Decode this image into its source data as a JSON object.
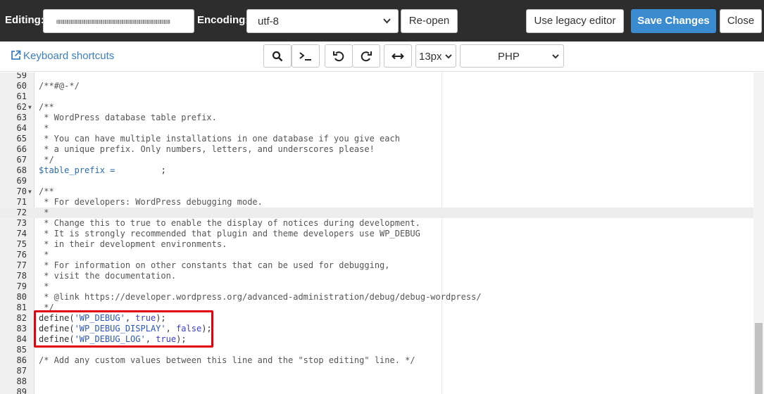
{
  "header": {
    "editing_label": "Editing:",
    "encoding_label": "Encoding:",
    "encoding_value": "utf-8",
    "reopen_label": "Re-open",
    "legacy_label": "Use legacy editor",
    "save_label": "Save Changes",
    "close_label": "Close"
  },
  "toolbar": {
    "shortcuts_label": "Keyboard shortcuts",
    "font_size": "13px",
    "mode": "PHP",
    "icons": [
      "search-icon",
      "terminal-icon",
      "undo-icon",
      "redo-icon",
      "wrap-icon"
    ]
  },
  "editor": {
    "line_numbers": [
      "59",
      "60",
      "61",
      "62",
      "63",
      "64",
      "65",
      "66",
      "67",
      "68",
      "69",
      "70",
      "71",
      "72",
      "73",
      "74",
      "75",
      "76",
      "77",
      "78",
      "79",
      "80",
      "81",
      "82",
      "83",
      "84",
      "85",
      "86",
      "87",
      "88",
      "89"
    ],
    "fold_markers": [
      "",
      "",
      "",
      "▼",
      "",
      "",
      "",
      "",
      "",
      "",
      "",
      "▼",
      "",
      "",
      "",
      "",
      "",
      "",
      "",
      "",
      "",
      "",
      "",
      "",
      "",
      "",
      "",
      "",
      "",
      "",
      ""
    ],
    "lines": [
      "",
      "/**#@-*/",
      "",
      "/**",
      " * WordPress database table prefix.",
      " *",
      " * You can have multiple installations in one database if you give each",
      " * a unique prefix. Only numbers, letters, and underscores please!",
      " */",
      "",
      "",
      "/**",
      " * For developers: WordPress debugging mode.",
      " *",
      " * Change this to true to enable the display of notices during development.",
      " * It is strongly recommended that plugin and theme developers use WP_DEBUG",
      " * in their development environments.",
      " *",
      " * For information on other constants that can be used for debugging,",
      " * visit the documentation.",
      " *",
      " * @link https://developer.wordpress.org/advanced-administration/debug/debug-wordpress/",
      " */",
      "",
      "",
      "",
      "",
      "/* Add any custom values between this line and the \"stop editing\" line. */",
      "",
      "",
      ""
    ],
    "table_prefix_line": {
      "var": "$table_prefix",
      "op": " = ",
      "end": ";"
    },
    "defines": [
      {
        "func": "define(",
        "str": "'WP_DEBUG'",
        "sep": ", ",
        "kw": "true",
        "end": ");"
      },
      {
        "func": "define(",
        "str": "'WP_DEBUG_DISPLAY'",
        "sep": ", ",
        "kw": "false",
        "end": ");"
      },
      {
        "func": "define(",
        "str": "'WP_DEBUG_LOG'",
        "sep": ", ",
        "kw": "true",
        "end": ");"
      }
    ],
    "active_line": "72"
  },
  "colors": {
    "header_bg": "#2d2d2d",
    "primary": "#3a8bd0",
    "highlight": "#e3000f",
    "link": "#3a7fc4"
  }
}
